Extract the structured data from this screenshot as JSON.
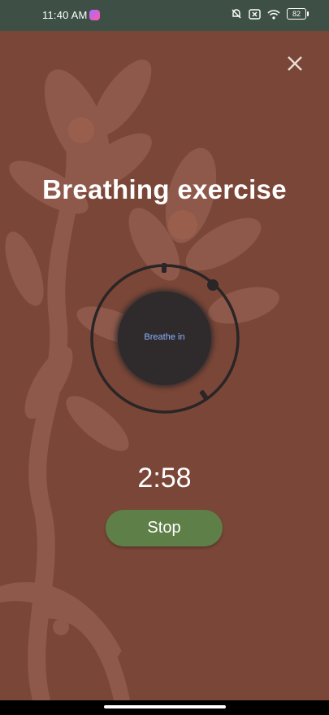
{
  "status_bar": {
    "time": "11:40 AM",
    "notification_icon": "messenger-icon",
    "icons": [
      "mute-bell-icon",
      "dismiss-icon",
      "wifi-icon",
      "battery-icon"
    ],
    "battery": "82"
  },
  "header": {
    "close_icon": "close-icon"
  },
  "exercise": {
    "title": "Breathing exercise",
    "instruction": "Breathe in",
    "timer": "2:58",
    "stop_label": "Stop"
  },
  "colors": {
    "background": "#7a4637",
    "status_bar": "#3e5045",
    "stop_button": "#5f7f49",
    "ball": "#2f2a2c",
    "instruction_text": "#8fb3ff"
  }
}
